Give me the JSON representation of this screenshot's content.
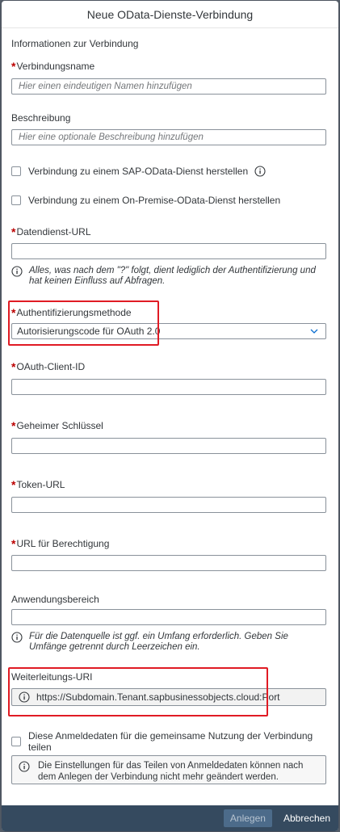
{
  "dialog": {
    "title": "Neue OData-Dienste-Verbindung"
  },
  "section": {
    "connection_info": "Informationen zur Verbindung"
  },
  "fields": {
    "connection_name": {
      "required_mark": "*",
      "label": "Verbindungsname",
      "placeholder": "Hier einen eindeutigen Namen hinzufügen"
    },
    "description": {
      "label": "Beschreibung",
      "placeholder": "Hier eine optionale Beschreibung hinzufügen"
    },
    "checkbox_sap": {
      "label": "Verbindung zu einem SAP-OData-Dienst herstellen",
      "checked": false
    },
    "checkbox_onprem": {
      "label": "Verbindung zu einem On-Premise-OData-Dienst herstellen",
      "checked": false
    },
    "data_service_url": {
      "required_mark": "*",
      "label": "Datendienst-URL",
      "value": "",
      "hint": "Alles, was nach dem \"?\" folgt, dient lediglich der Authentifizierung und hat keinen Einfluss auf Abfragen."
    },
    "auth_method": {
      "required_mark": "*",
      "label": "Authentifizierungsmethode",
      "selected": "Autorisierungscode für OAuth 2.0"
    },
    "oauth_client_id": {
      "required_mark": "*",
      "label": "OAuth-Client-ID",
      "value": ""
    },
    "secret_key": {
      "required_mark": "*",
      "label": "Geheimer Schlüssel",
      "value": ""
    },
    "token_url": {
      "required_mark": "*",
      "label": "Token-URL",
      "value": ""
    },
    "auth_url": {
      "required_mark": "*",
      "label": "URL für Berechtigung",
      "value": ""
    },
    "scope": {
      "label": "Anwendungsbereich",
      "value": "",
      "hint": "Für die Datenquelle ist ggf. ein Umfang erforderlich. Geben Sie Umfänge getrennt durch Leerzeichen ein."
    },
    "redirect_uri": {
      "label": "Weiterleitungs-URI",
      "value": "https://Subdomain.Tenant.sapbusinessobjects.cloud:Port"
    },
    "share_credentials": {
      "label": "Diese Anmeldedaten für die gemeinsame Nutzung der Verbindung teilen",
      "checked": false,
      "note": "Die Einstellungen für das Teilen von Anmeldedaten können nach dem Anlegen der Verbindung nicht mehr geändert werden."
    }
  },
  "footer": {
    "create_label": "Anlegen",
    "cancel_label": "Abbrechen"
  },
  "colors": {
    "required": "#bb0000",
    "highlight": "#e01b24",
    "footer_bg": "#354a5f"
  },
  "icons": {
    "info": "info-icon",
    "dropdown": "chevron-down-icon"
  }
}
